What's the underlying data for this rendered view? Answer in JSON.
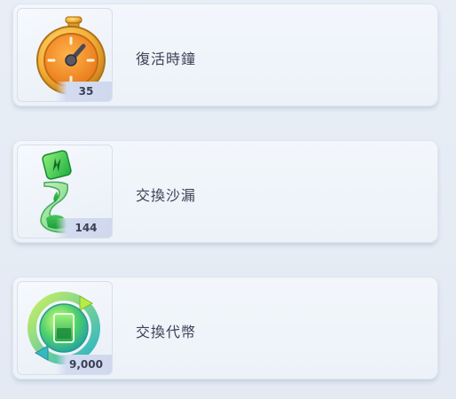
{
  "items": [
    {
      "name": "復活時鐘",
      "count": "35",
      "icon": "stopwatch-icon"
    },
    {
      "name": "交換沙漏",
      "count": "144",
      "icon": "hourglass-icon"
    },
    {
      "name": "交換代幣",
      "count": "9,000",
      "icon": "exchange-token-icon"
    }
  ],
  "colors": {
    "card_background": "#eef3f9",
    "text": "#3c4156",
    "badge": "#d3dbef"
  }
}
